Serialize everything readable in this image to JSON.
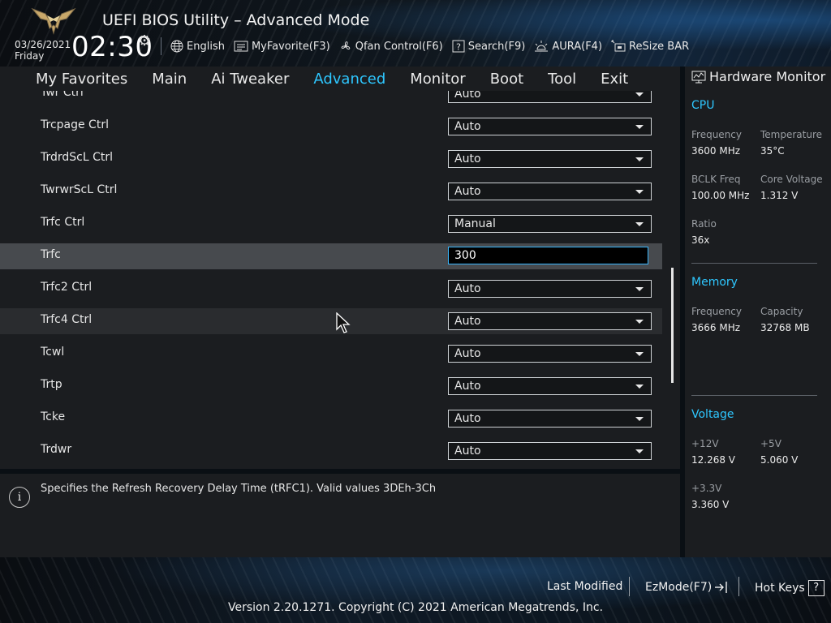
{
  "header": {
    "title": "UEFI BIOS Utility – Advanced Mode",
    "date": "03/26/2021",
    "day": "Friday",
    "time": "02:30",
    "toolbar": [
      {
        "label": "English",
        "icon": "globe-icon"
      },
      {
        "label": "MyFavorite(F3)",
        "icon": "favorite-icon"
      },
      {
        "label": "Qfan Control(F6)",
        "icon": "fan-icon"
      },
      {
        "label": "Search(F9)",
        "icon": "search-icon"
      },
      {
        "label": "AURA(F4)",
        "icon": "aura-icon"
      },
      {
        "label": "ReSize BAR",
        "icon": "resize-bar-icon"
      }
    ]
  },
  "nav": {
    "tabs": [
      "My Favorites",
      "Main",
      "Ai Tweaker",
      "Advanced",
      "Monitor",
      "Boot",
      "Tool",
      "Exit"
    ],
    "active": "Advanced"
  },
  "settings": [
    {
      "label": "Twr Ctrl",
      "value": "Auto",
      "type": "dropdown"
    },
    {
      "label": "Trcpage Ctrl",
      "value": "Auto",
      "type": "dropdown"
    },
    {
      "label": "TrdrdScL Ctrl",
      "value": "Auto",
      "type": "dropdown"
    },
    {
      "label": "TwrwrScL Ctrl",
      "value": "Auto",
      "type": "dropdown"
    },
    {
      "label": "Trfc Ctrl",
      "value": "Manual",
      "type": "dropdown"
    },
    {
      "label": "Trfc",
      "value": "300",
      "type": "text",
      "state": "selected"
    },
    {
      "label": "Trfc2 Ctrl",
      "value": "Auto",
      "type": "dropdown"
    },
    {
      "label": "Trfc4 Ctrl",
      "value": "Auto",
      "type": "dropdown",
      "state": "hover"
    },
    {
      "label": "Tcwl",
      "value": "Auto",
      "type": "dropdown"
    },
    {
      "label": "Trtp",
      "value": "Auto",
      "type": "dropdown"
    },
    {
      "label": "Tcke",
      "value": "Auto",
      "type": "dropdown"
    },
    {
      "label": "Trdwr",
      "value": "Auto",
      "type": "dropdown"
    }
  ],
  "help": {
    "text": "Specifies the Refresh Recovery Delay Time (tRFC1). Valid values 3DEh-3Ch"
  },
  "hardware_monitor": {
    "title": "Hardware Monitor",
    "cpu": {
      "section": "CPU",
      "frequency_label": "Frequency",
      "frequency": "3600 MHz",
      "temperature_label": "Temperature",
      "temperature": "35°C",
      "bclk_label": "BCLK Freq",
      "bclk": "100.00 MHz",
      "core_voltage_label": "Core Voltage",
      "core_voltage": "1.312 V",
      "ratio_label": "Ratio",
      "ratio": "36x"
    },
    "memory": {
      "section": "Memory",
      "frequency_label": "Frequency",
      "frequency": "3666 MHz",
      "capacity_label": "Capacity",
      "capacity": "32768 MB"
    },
    "voltage": {
      "section": "Voltage",
      "v12_label": "+12V",
      "v12": "12.268 V",
      "v5_label": "+5V",
      "v5": "5.060 V",
      "v33_label": "+3.3V",
      "v33": "3.360 V"
    }
  },
  "footer": {
    "last_modified": "Last Modified",
    "ezmode": "EzMode(F7)",
    "hotkeys": "Hot Keys",
    "hotkeys_glyph": "?",
    "version": "Version 2.20.1271. Copyright (C) 2021 American Megatrends, Inc."
  },
  "colors": {
    "accent": "#2ec7ff",
    "panel": "#1b1d20",
    "selected_row": "#474a4e",
    "hover_row": "#2a2c2f"
  }
}
